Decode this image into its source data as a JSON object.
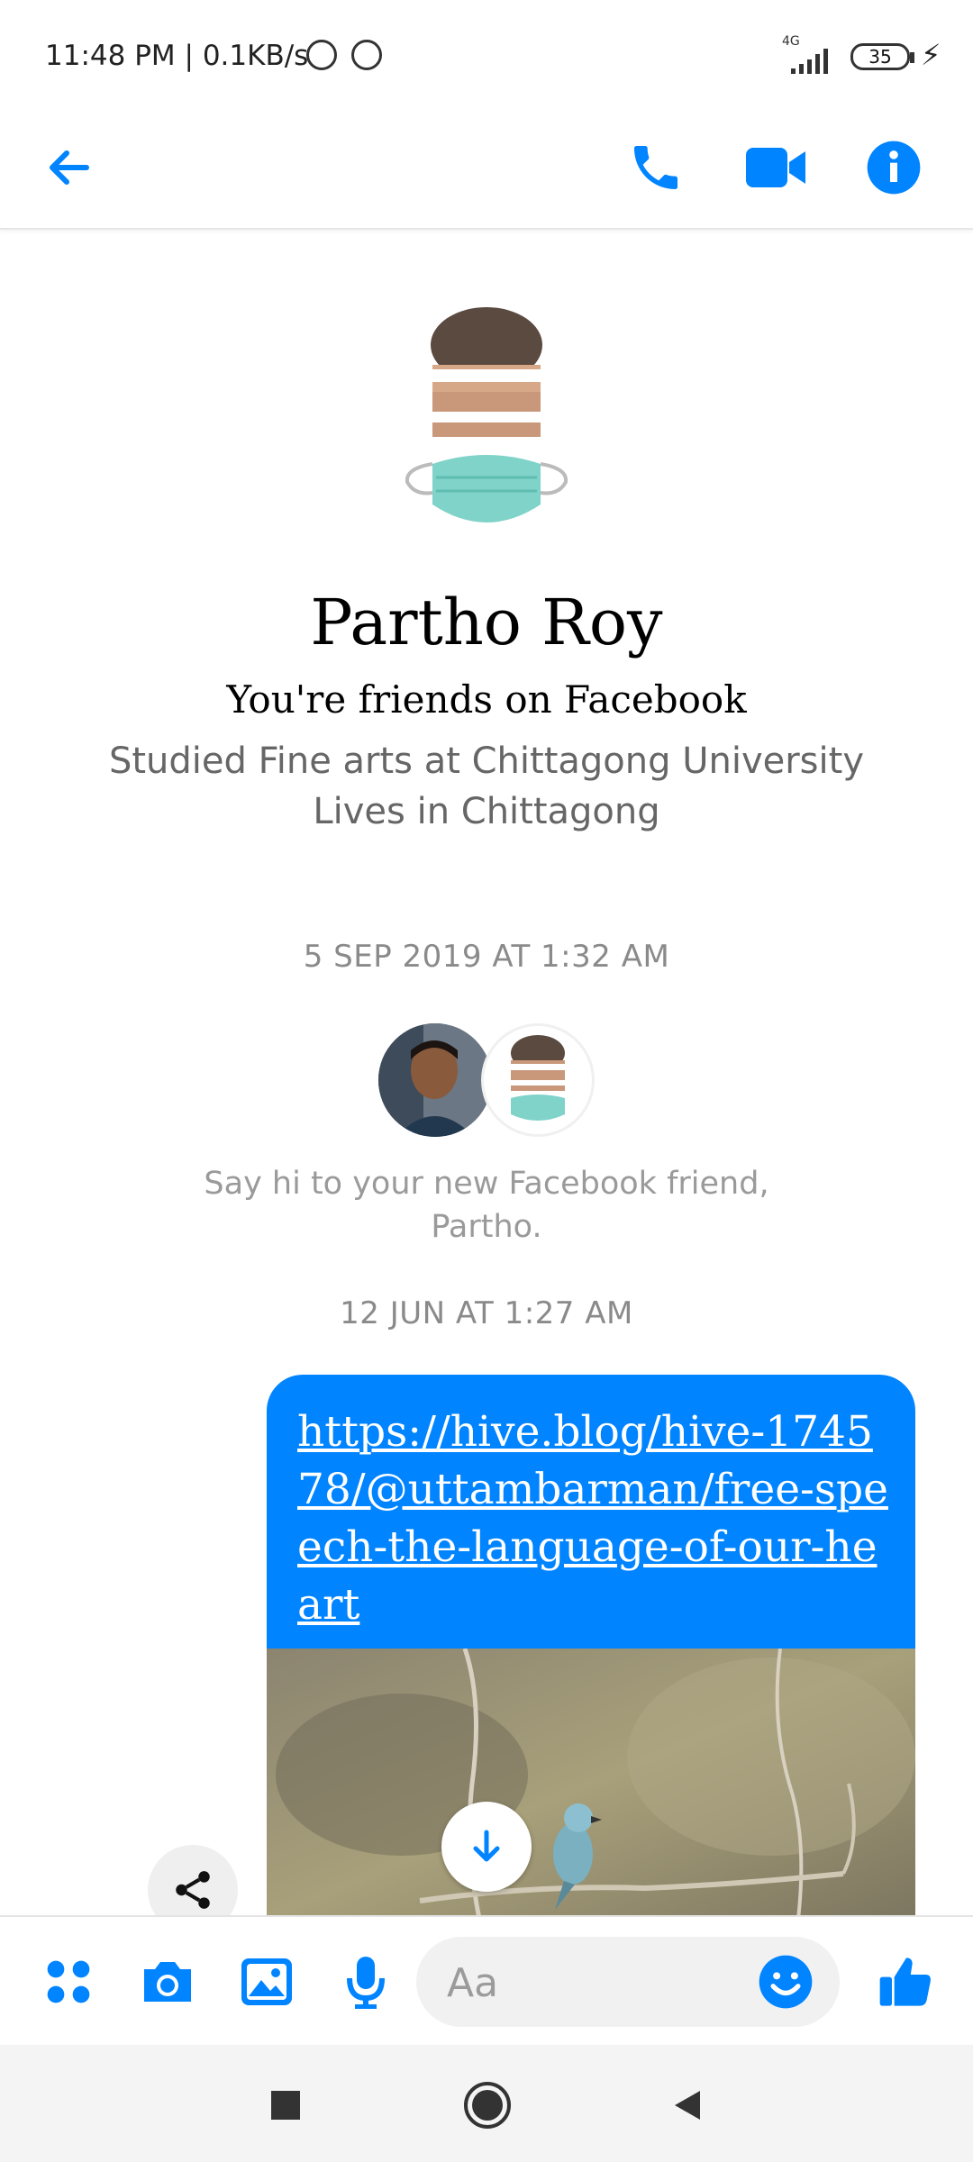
{
  "status_bar": {
    "time": "11:48 PM",
    "net_speed": "0.1KB/s",
    "separator": "|",
    "signal": "4G",
    "battery": "35"
  },
  "header": {
    "icons": [
      "back-arrow-icon",
      "phone-icon",
      "video-camera-icon",
      "info-icon"
    ],
    "accent_color": "#0084ff"
  },
  "profile": {
    "name": "Partho Roy",
    "friend_status": "You're friends on Facebook",
    "info_lines": [
      "Studied Fine arts at Chittagong University",
      "Lives in Chittagong"
    ]
  },
  "thread": {
    "timestamps": [
      "5 SEP 2019 AT 1:32 AM",
      "12 JUN AT 1:27 AM"
    ],
    "say_hi": "Say hi to your new Facebook friend, Partho.",
    "message": {
      "link": "https://hive.blog/hive-174578/@uttambarman/free-speech-the-language-of-our-heart",
      "bubble_color": "#0084ff"
    }
  },
  "composer": {
    "placeholder": "Aa",
    "icons": [
      "apps-icon",
      "camera-icon",
      "gallery-icon",
      "microphone-icon",
      "emoji-icon",
      "thumbs-up-icon"
    ]
  },
  "nav": {
    "icons": [
      "recents-square-icon",
      "home-circle-icon",
      "back-triangle-icon"
    ]
  }
}
